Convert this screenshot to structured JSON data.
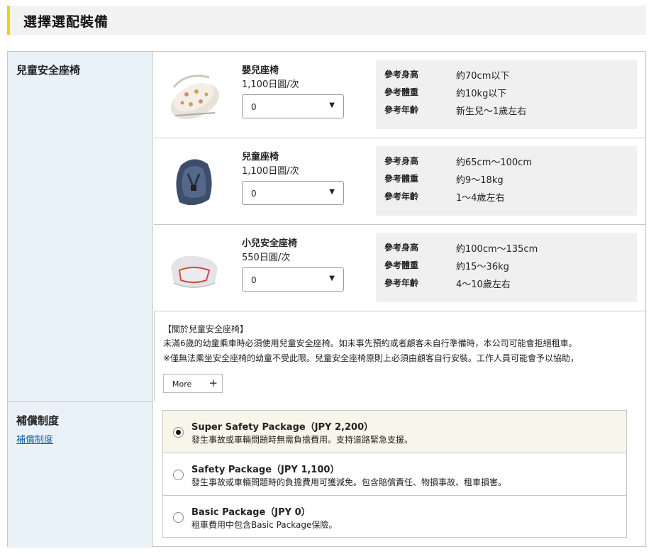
{
  "page": {
    "title": "選擇選配裝備"
  },
  "child_seats": {
    "section_label": "兒童安全座椅",
    "items": [
      {
        "name": "嬰兒座椅",
        "price": "1,100日圓/次",
        "qty": "0",
        "ref": [
          {
            "label": "參考身高",
            "value": "約70cm以下"
          },
          {
            "label": "參考體重",
            "value": "約10kg以下"
          },
          {
            "label": "參考年齡",
            "value": "新生兒〜1歲左右"
          }
        ]
      },
      {
        "name": "兒童座椅",
        "price": "1,100日圓/次",
        "qty": "0",
        "ref": [
          {
            "label": "參考身高",
            "value": "約65cm〜100cm"
          },
          {
            "label": "參考體重",
            "value": "約9〜18kg"
          },
          {
            "label": "參考年齡",
            "value": "1〜4歲左右"
          }
        ]
      },
      {
        "name": "小兒安全座椅",
        "price": "550日圓/次",
        "qty": "0",
        "ref": [
          {
            "label": "參考身高",
            "value": "約100cm〜135cm"
          },
          {
            "label": "參考體重",
            "value": "約15〜36kg"
          },
          {
            "label": "參考年齡",
            "value": "4〜10歲左右"
          }
        ]
      }
    ],
    "note": {
      "title": "【關於兒童安全座椅】",
      "line1": "未滿6歲的幼童乘車時必須使用兒童安全座椅。如未事先預約或者顧客未自行準備時，本公司可能會拒絕租車。",
      "line2": "※僅無法乘坐安全座椅的幼童不受此限。兒童安全座椅原則上必須由顧客自行安裝。工作人員可能會予以協助，",
      "more_label": "More",
      "more_icon": "+"
    }
  },
  "compensation": {
    "section_label": "補償制度",
    "link_label": "補償制度",
    "packages": [
      {
        "name": "Super Safety Package（JPY 2,200）",
        "desc": "發生事故或車輛問題時無需負擔費用。支持道路緊急支援。",
        "selected": true
      },
      {
        "name": "Safety Package（JPY 1,100）",
        "desc": "發生事故或車輛問題時的負擔費用可獲減免。包含賠償責任、物損事故、租車損害。",
        "selected": false
      },
      {
        "name": "Basic Package（JPY 0）",
        "desc": "租車費用中包含Basic Package保險。",
        "selected": false
      }
    ]
  },
  "colors": {
    "accent": "#f0d000",
    "label_bg": "#e9f2f8",
    "selected_bg": "#f8f6ea",
    "link": "#1a5ea8"
  }
}
